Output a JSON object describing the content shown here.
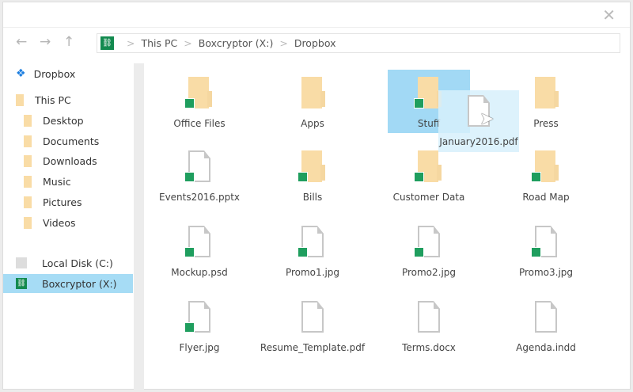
{
  "nav": {
    "back": "←",
    "forward": "→",
    "up": "↑"
  },
  "address": {
    "logo": "⛓",
    "crumbs": [
      "This PC",
      "Boxcryptor (X:)",
      "Dropbox"
    ]
  },
  "sidebar": [
    {
      "label": "Dropbox",
      "icon": "dropbox-icon"
    },
    {
      "label": "This PC",
      "icon": "folder-icon"
    },
    {
      "label": "Desktop",
      "icon": "folder-icon"
    },
    {
      "label": "Documents",
      "icon": "folder-icon"
    },
    {
      "label": "Downloads",
      "icon": "folder-icon"
    },
    {
      "label": "Music",
      "icon": "folder-icon"
    },
    {
      "label": "Pictures",
      "icon": "folder-icon"
    },
    {
      "label": "Videos",
      "icon": "folder-icon"
    },
    {
      "label": "Local Disk (C:)",
      "icon": "drive-icon"
    },
    {
      "label": "Boxcryptor (X:)",
      "icon": "boxcryptor-icon",
      "selected": true
    }
  ],
  "items": [
    {
      "name": "Office Files",
      "type": "folder",
      "enc": true
    },
    {
      "name": "Apps",
      "type": "folder",
      "enc": false
    },
    {
      "name": "Stuff",
      "type": "folder",
      "enc": true,
      "selected": true
    },
    {
      "name": "Press",
      "type": "folder",
      "enc": false
    },
    {
      "name": "Events2016.pptx",
      "type": "file",
      "enc": true
    },
    {
      "name": "Bills",
      "type": "folder",
      "enc": true
    },
    {
      "name": "Customer Data",
      "type": "folder",
      "enc": true
    },
    {
      "name": "Road Map",
      "type": "folder",
      "enc": true
    },
    {
      "name": "Mockup.psd",
      "type": "file",
      "enc": true
    },
    {
      "name": "Promo1.jpg",
      "type": "file",
      "enc": true
    },
    {
      "name": "Promo2.jpg",
      "type": "file",
      "enc": true
    },
    {
      "name": "Promo3.jpg",
      "type": "file",
      "enc": true
    },
    {
      "name": "Flyer.jpg",
      "type": "file",
      "enc": true
    },
    {
      "name": "Resume_Template.pdf",
      "type": "file",
      "enc": false
    },
    {
      "name": "Terms.docx",
      "type": "file",
      "enc": false
    },
    {
      "name": "Agenda.indd",
      "type": "file",
      "enc": false
    }
  ],
  "dragging": {
    "name": "January2016.pdf"
  }
}
